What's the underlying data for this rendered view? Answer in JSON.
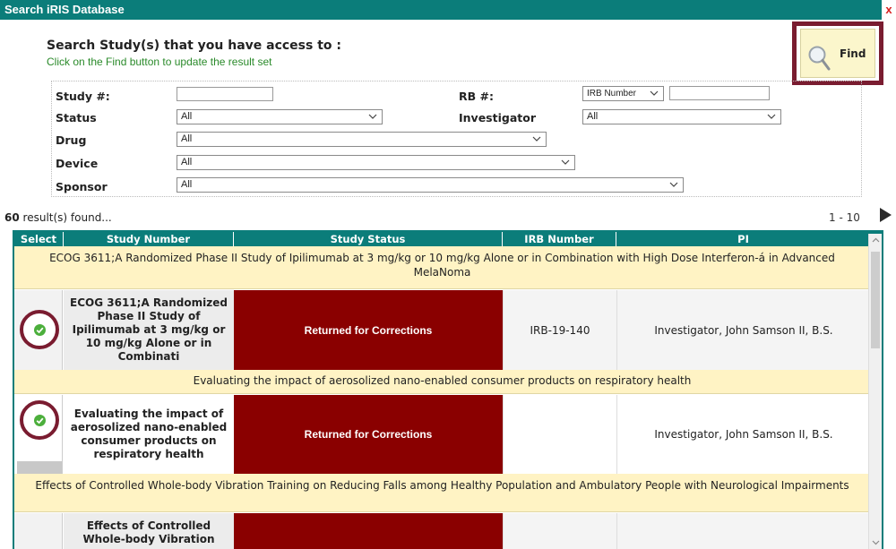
{
  "window": {
    "title": "Search iRIS Database",
    "close_label": "x"
  },
  "header": {
    "heading": "Search Study(s) that you have access to :",
    "subheading": "Click on the Find button to update the result set"
  },
  "find_button": {
    "label": "Find",
    "icon": "magnifier-icon"
  },
  "criteria": {
    "study_label": "Study #:",
    "study_value": "",
    "irb_label": "RB #:",
    "irb_type_value": "IRB Number",
    "irb_value": "",
    "status_label": "Status",
    "status_value": "All",
    "investigator_label": "Investigator",
    "investigator_value": "All",
    "drug_label": "Drug",
    "drug_value": "All",
    "device_label": "Device",
    "device_value": "All",
    "sponsor_label": "Sponsor",
    "sponsor_value": "All"
  },
  "results": {
    "count": "60",
    "suffix": "result(s) found...",
    "range": "1 - 10"
  },
  "table": {
    "headers": [
      "Select",
      "Study Number",
      "Study Status",
      "IRB Number",
      "PI"
    ],
    "groups": [
      {
        "title": "ECOG 3611;A Randomized Phase II Study of Ipilimumab at 3 mg/kg or 10 mg/kg Alone or in Combination with High Dose Interferon-á in Advanced MelaNoma",
        "study_number": "ECOG 3611;A Randomized Phase II Study of Ipilimumab at 3 mg/kg or 10 mg/kg Alone or in Combinati",
        "status": "Returned for Corrections",
        "irb_number": "IRB-19-140",
        "pi": "Investigator, John Samson II, B.S."
      },
      {
        "title": "Evaluating the impact of aerosolized nano-enabled consumer products on respiratory health",
        "study_number": "Evaluating the impact of aerosolized nano-enabled consumer products on respiratory health",
        "status": "Returned for Corrections",
        "irb_number": "",
        "pi": "Investigator, John Samson II, B.S."
      },
      {
        "title": "Effects of Controlled Whole-body Vibration Training on Reducing Falls among Healthy Population and Ambulatory People with Neurological Impairments",
        "study_number": "Effects of Controlled Whole-body Vibration",
        "status": "",
        "irb_number": "",
        "pi": ""
      }
    ]
  },
  "colors": {
    "title_bar": "#0b7d7a",
    "highlight_outline": "#7a1c30",
    "status_cell": "#8a0000",
    "group_row": "#fff3c4",
    "check_green": "#4caf3c"
  }
}
